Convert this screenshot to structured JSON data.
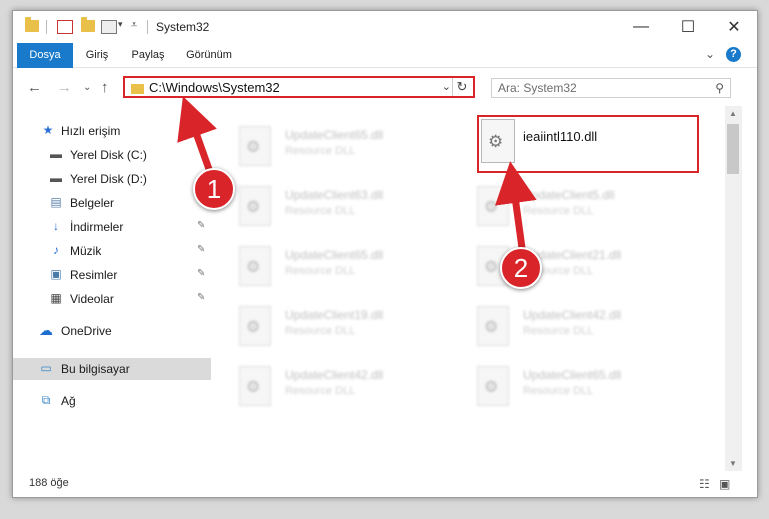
{
  "window": {
    "title": "System32",
    "controls": {
      "minimize": "—",
      "maximize": "☐",
      "close": "✕"
    }
  },
  "ribbon": {
    "tabs": [
      "Dosya",
      "Giriş",
      "Paylaş",
      "Görünüm"
    ],
    "collapse_glyph": "⌄",
    "help": "?"
  },
  "nav": {
    "back": "←",
    "forward": "→",
    "recent": "⌄",
    "up": "↑",
    "address_value": "C:\\Windows\\System32",
    "address_chevron": "⌄",
    "refresh": "↻",
    "search_placeholder": "Ara: System32",
    "search_icon": "search-icon"
  },
  "sidebar": {
    "items": [
      {
        "label": "Hızlı erişim",
        "icon": "star-icon",
        "glyph": "★",
        "color": "#2b6fd6"
      },
      {
        "label": "Yerel Disk (C:)",
        "icon": "drive-icon",
        "glyph": "▬",
        "color": "#555555"
      },
      {
        "label": "Yerel Disk (D:)",
        "icon": "drive-icon",
        "glyph": "▬",
        "color": "#555555"
      },
      {
        "label": "Belgeler",
        "icon": "documents-icon",
        "glyph": "▤",
        "color": "#5a7fa8"
      },
      {
        "label": "İndirmeler",
        "icon": "download-icon",
        "glyph": "↓",
        "color": "#2b6fd6"
      },
      {
        "label": "Müzik",
        "icon": "music-icon",
        "glyph": "♪",
        "color": "#2b6fd6"
      },
      {
        "label": "Resimler",
        "icon": "pictures-icon",
        "glyph": "▣",
        "color": "#4a7ba8"
      },
      {
        "label": "Videolar",
        "icon": "video-icon",
        "glyph": "▦",
        "color": "#444444"
      },
      {
        "label": "OneDrive",
        "icon": "cloud-icon",
        "glyph": "☁",
        "color": "#1e6fd0"
      },
      {
        "label": "Bu bilgisayar",
        "icon": "computer-icon",
        "glyph": "▭",
        "color": "#3a87c8"
      },
      {
        "label": "Ağ",
        "icon": "network-icon",
        "glyph": "⧉",
        "color": "#3a87c8"
      }
    ],
    "pinned_glyph": "📌"
  },
  "files": [
    {
      "name": "UpdateClient65.dll",
      "type": "Resource DLL"
    },
    {
      "name": "UpdateClient63.dll",
      "type": "Resource DLL"
    },
    {
      "name": "UpdateClient5.dll",
      "type": "Resource DLL"
    },
    {
      "name": "UpdateClient65.dll",
      "type": "Resource DLL"
    },
    {
      "name": "UpdateClient21.dll",
      "type": "Resource DLL"
    },
    {
      "name": "UpdateClient19.dll",
      "type": "Resource DLL"
    },
    {
      "name": "UpdateClient42.dll",
      "type": "Resource DLL"
    },
    {
      "name": "UpdateClient42.dll",
      "type": "Resource DLL"
    },
    {
      "name": "UpdateClient65.dll",
      "type": "Resource DLL"
    }
  ],
  "highlighted_file": {
    "name": "ieaiintl110.dll"
  },
  "callouts": [
    "1",
    "2"
  ],
  "status": {
    "item_count": "188 öğe"
  },
  "colors": {
    "accent": "#1979ca",
    "highlight": "#d9252a",
    "selection": "#dadada"
  }
}
